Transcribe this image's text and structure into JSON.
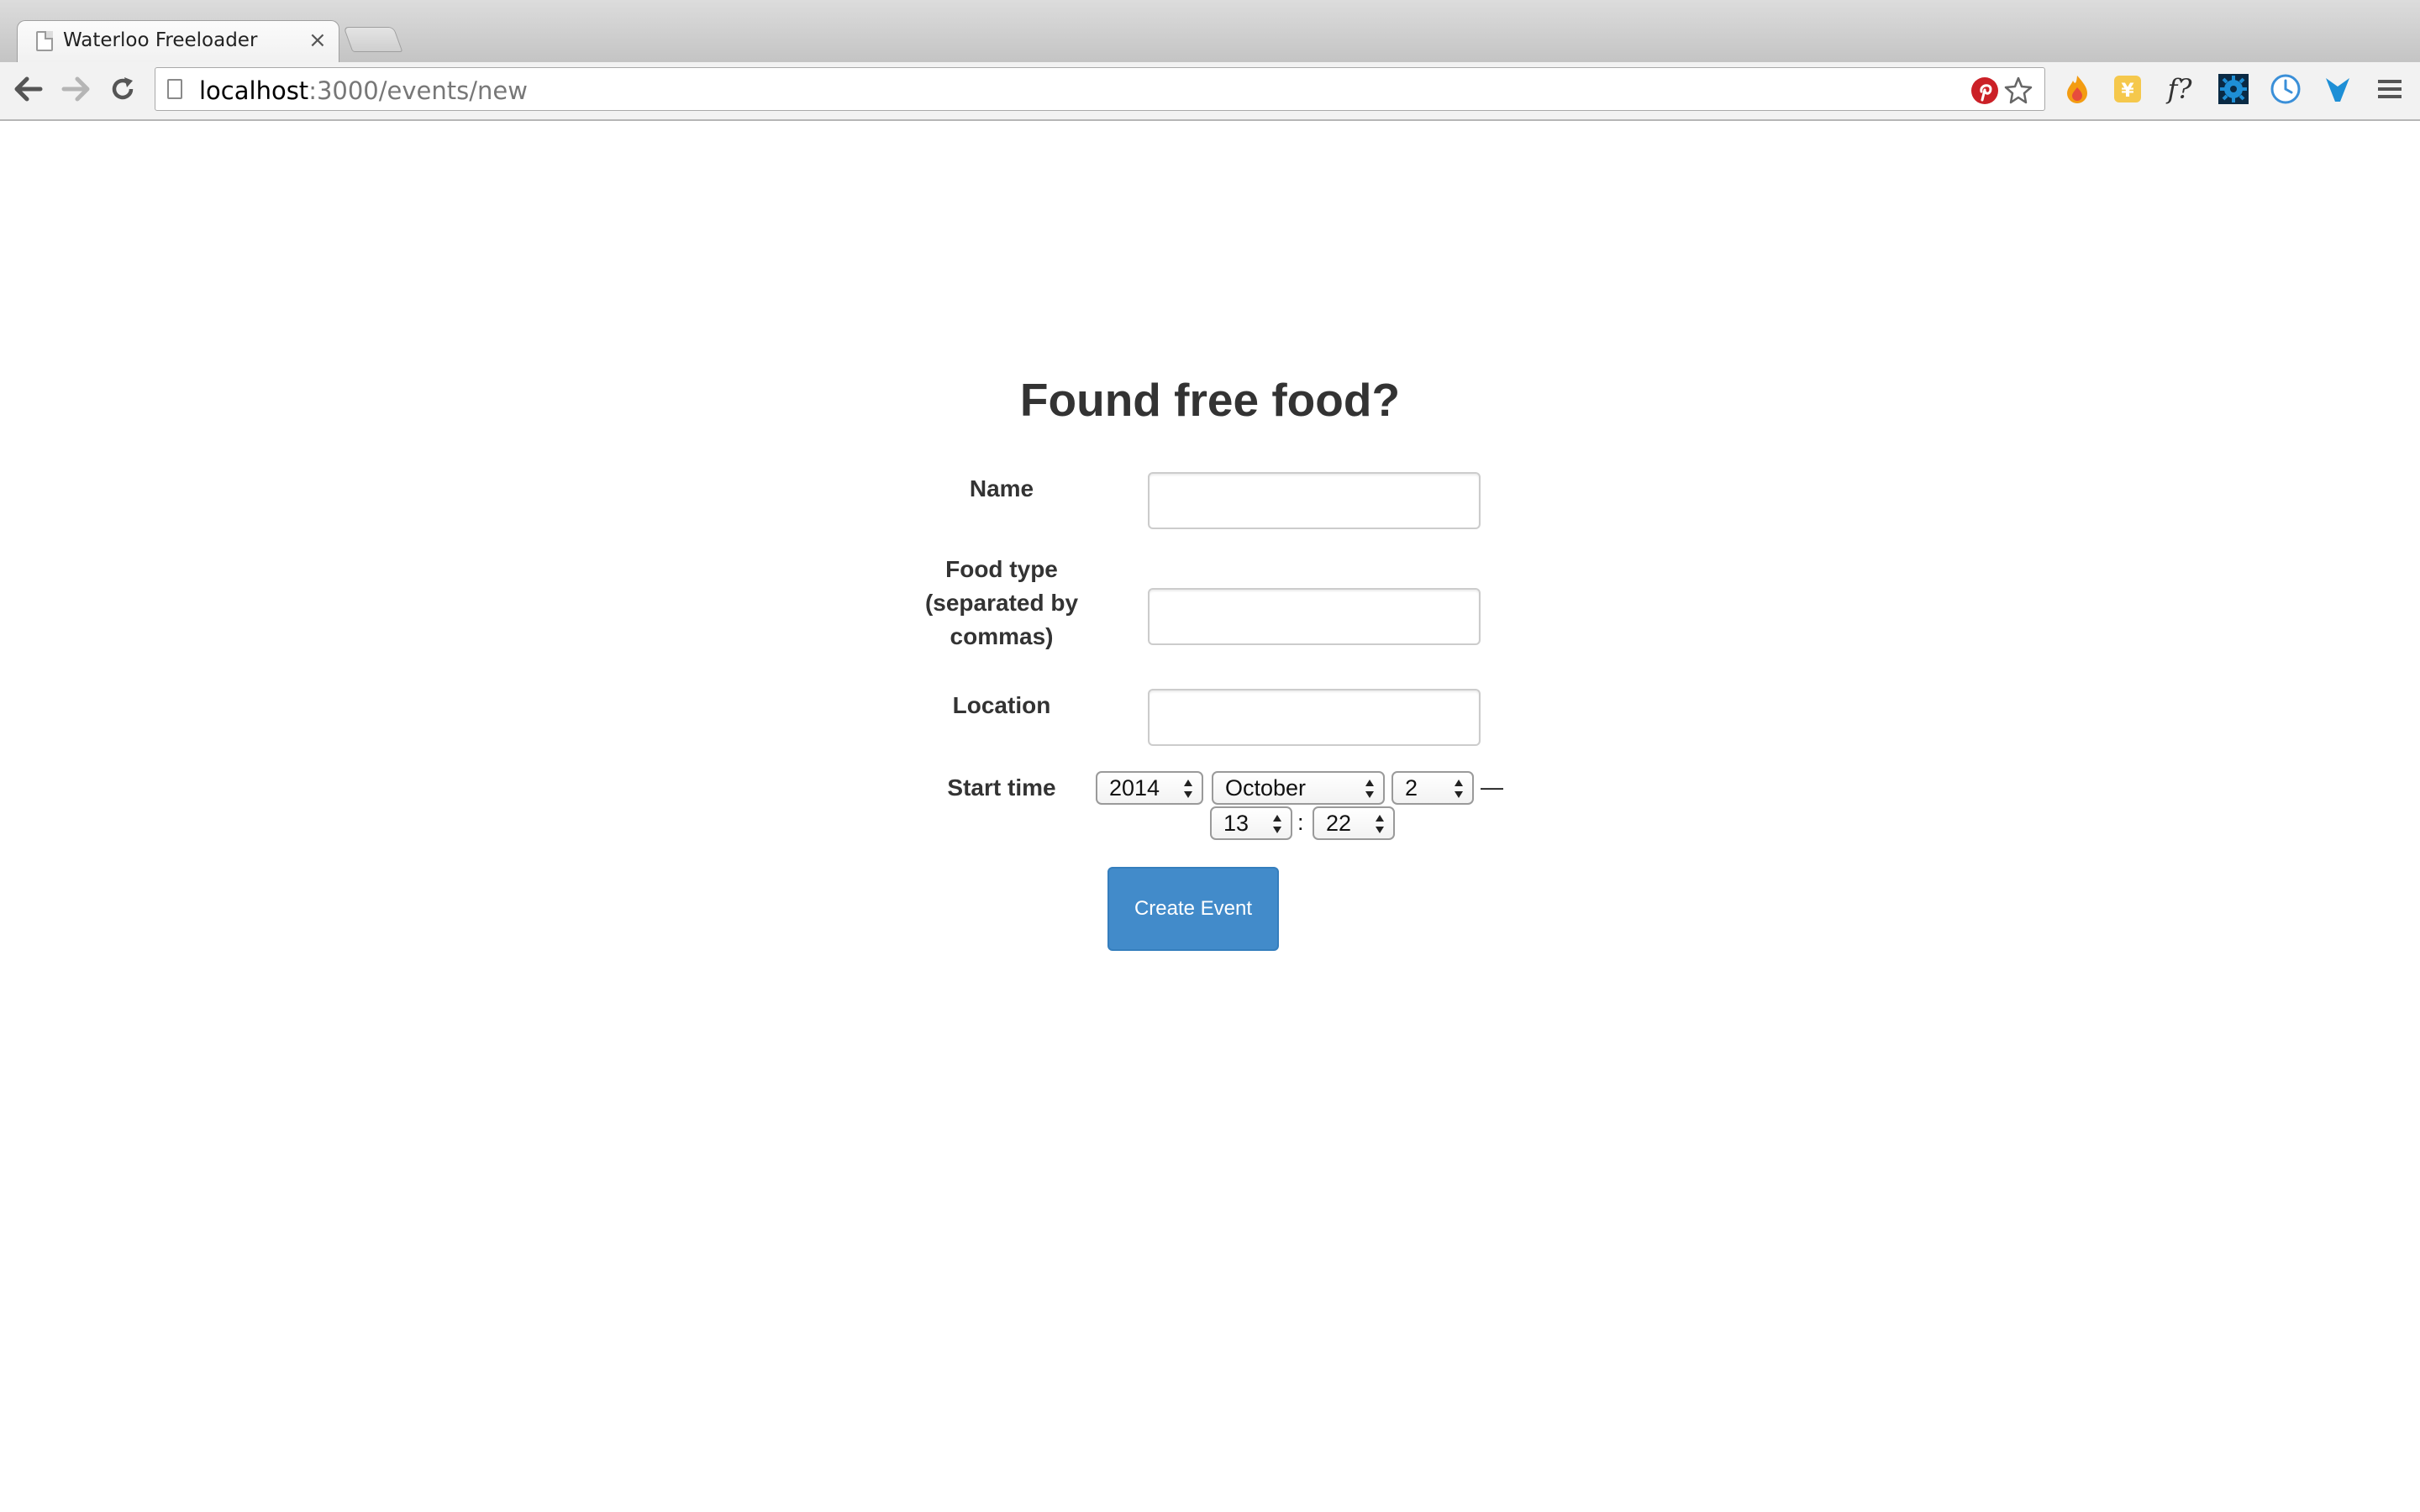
{
  "browser": {
    "tab": {
      "title": "Waterloo Freeloader"
    },
    "url": {
      "host": "localhost",
      "path": ":3000/events/new"
    },
    "icons": {
      "back": "arrow-left-icon",
      "forward": "arrow-right-icon",
      "reload": "reload-icon",
      "pinterest": "pinterest-icon",
      "bookmark": "star-icon",
      "extensions": [
        "fire-icon",
        "yen-icon",
        "formula-icon",
        "gear-icon",
        "clock-icon",
        "v-icon"
      ],
      "menu": "hamburger-menu-icon"
    },
    "colors": {
      "pinterest": "#cb2027",
      "fire": "#f39c12",
      "yen": "#f5c84c",
      "gear": "#1e8fd6",
      "v": "#1e8fd6"
    }
  },
  "page": {
    "heading": "Found free food?",
    "form": {
      "name_label": "Name",
      "name_value": "",
      "food_type_label_lines": [
        "Food type",
        "(separated by",
        "commas)"
      ],
      "food_type_value": "",
      "location_label": "Location",
      "location_value": "",
      "start_time_label": "Start time",
      "start_time": {
        "year": "2014",
        "month": "October",
        "day": "2",
        "date_time_separator": "—",
        "hour": "13",
        "time_separator": ":",
        "minute": "22"
      },
      "submit_label": "Create Event"
    },
    "colors": {
      "primary": "#428bca",
      "text": "#333333"
    }
  }
}
